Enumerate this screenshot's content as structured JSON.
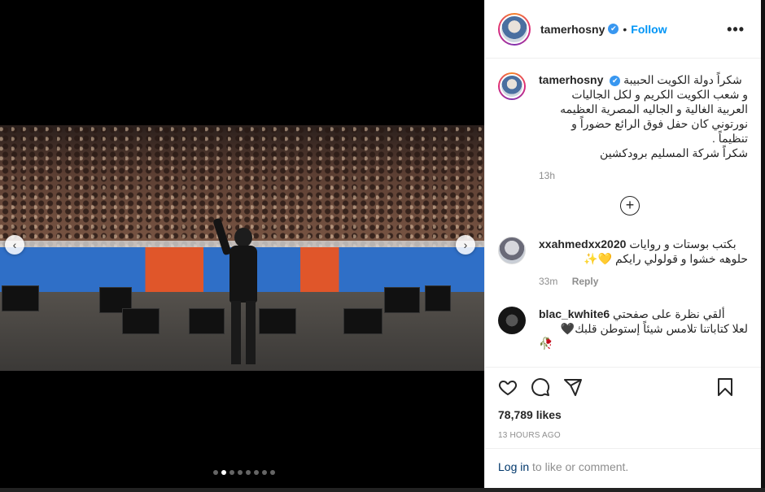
{
  "post": {
    "username": "tamerhosny",
    "verified_glyph": "✔",
    "bullet": "•",
    "follow_label": "Follow",
    "more_label": "•••"
  },
  "caption": {
    "username": "tamerhosny",
    "lines": [
      "شكراً دولة الكويت الحبيبة",
      "و شعب الكويت الكريم و لكل الجاليات",
      "العربية الغالية و الجاليه المصرية العظيمه",
      "نورتوني كان حفل فوق الرائع حضوراً و",
      "تنظيماً .",
      "شكراً شركة المسليم برودكشين"
    ],
    "time": "13h"
  },
  "load_more_glyph": "+",
  "comments": [
    {
      "username": "xxahmedxx2020",
      "text_line1": "بكتب بوستات و روايات",
      "text_line2": "حلوهه خشوا و قولولي رايكم 💛✨",
      "time": "33m",
      "reply_label": "Reply"
    },
    {
      "username": "blac_kwhite6",
      "text_line1": "ألقي نظرة على صفحتي",
      "text_line2": "لعلا كتاباتنا تلامس شيئاً إستوطن قلبك🖤",
      "text_line3": "🥀"
    }
  ],
  "stats": {
    "likes": "78,789 likes",
    "timestamp": "13 HOURS AGO"
  },
  "login": {
    "link": "Log in",
    "rest": " to like or comment."
  },
  "carousel": {
    "prev_glyph": "‹",
    "next_glyph": "›",
    "count": 8,
    "active_index": 1
  },
  "icons": [
    "heart-icon",
    "comment-icon",
    "share-icon",
    "bookmark-icon"
  ]
}
